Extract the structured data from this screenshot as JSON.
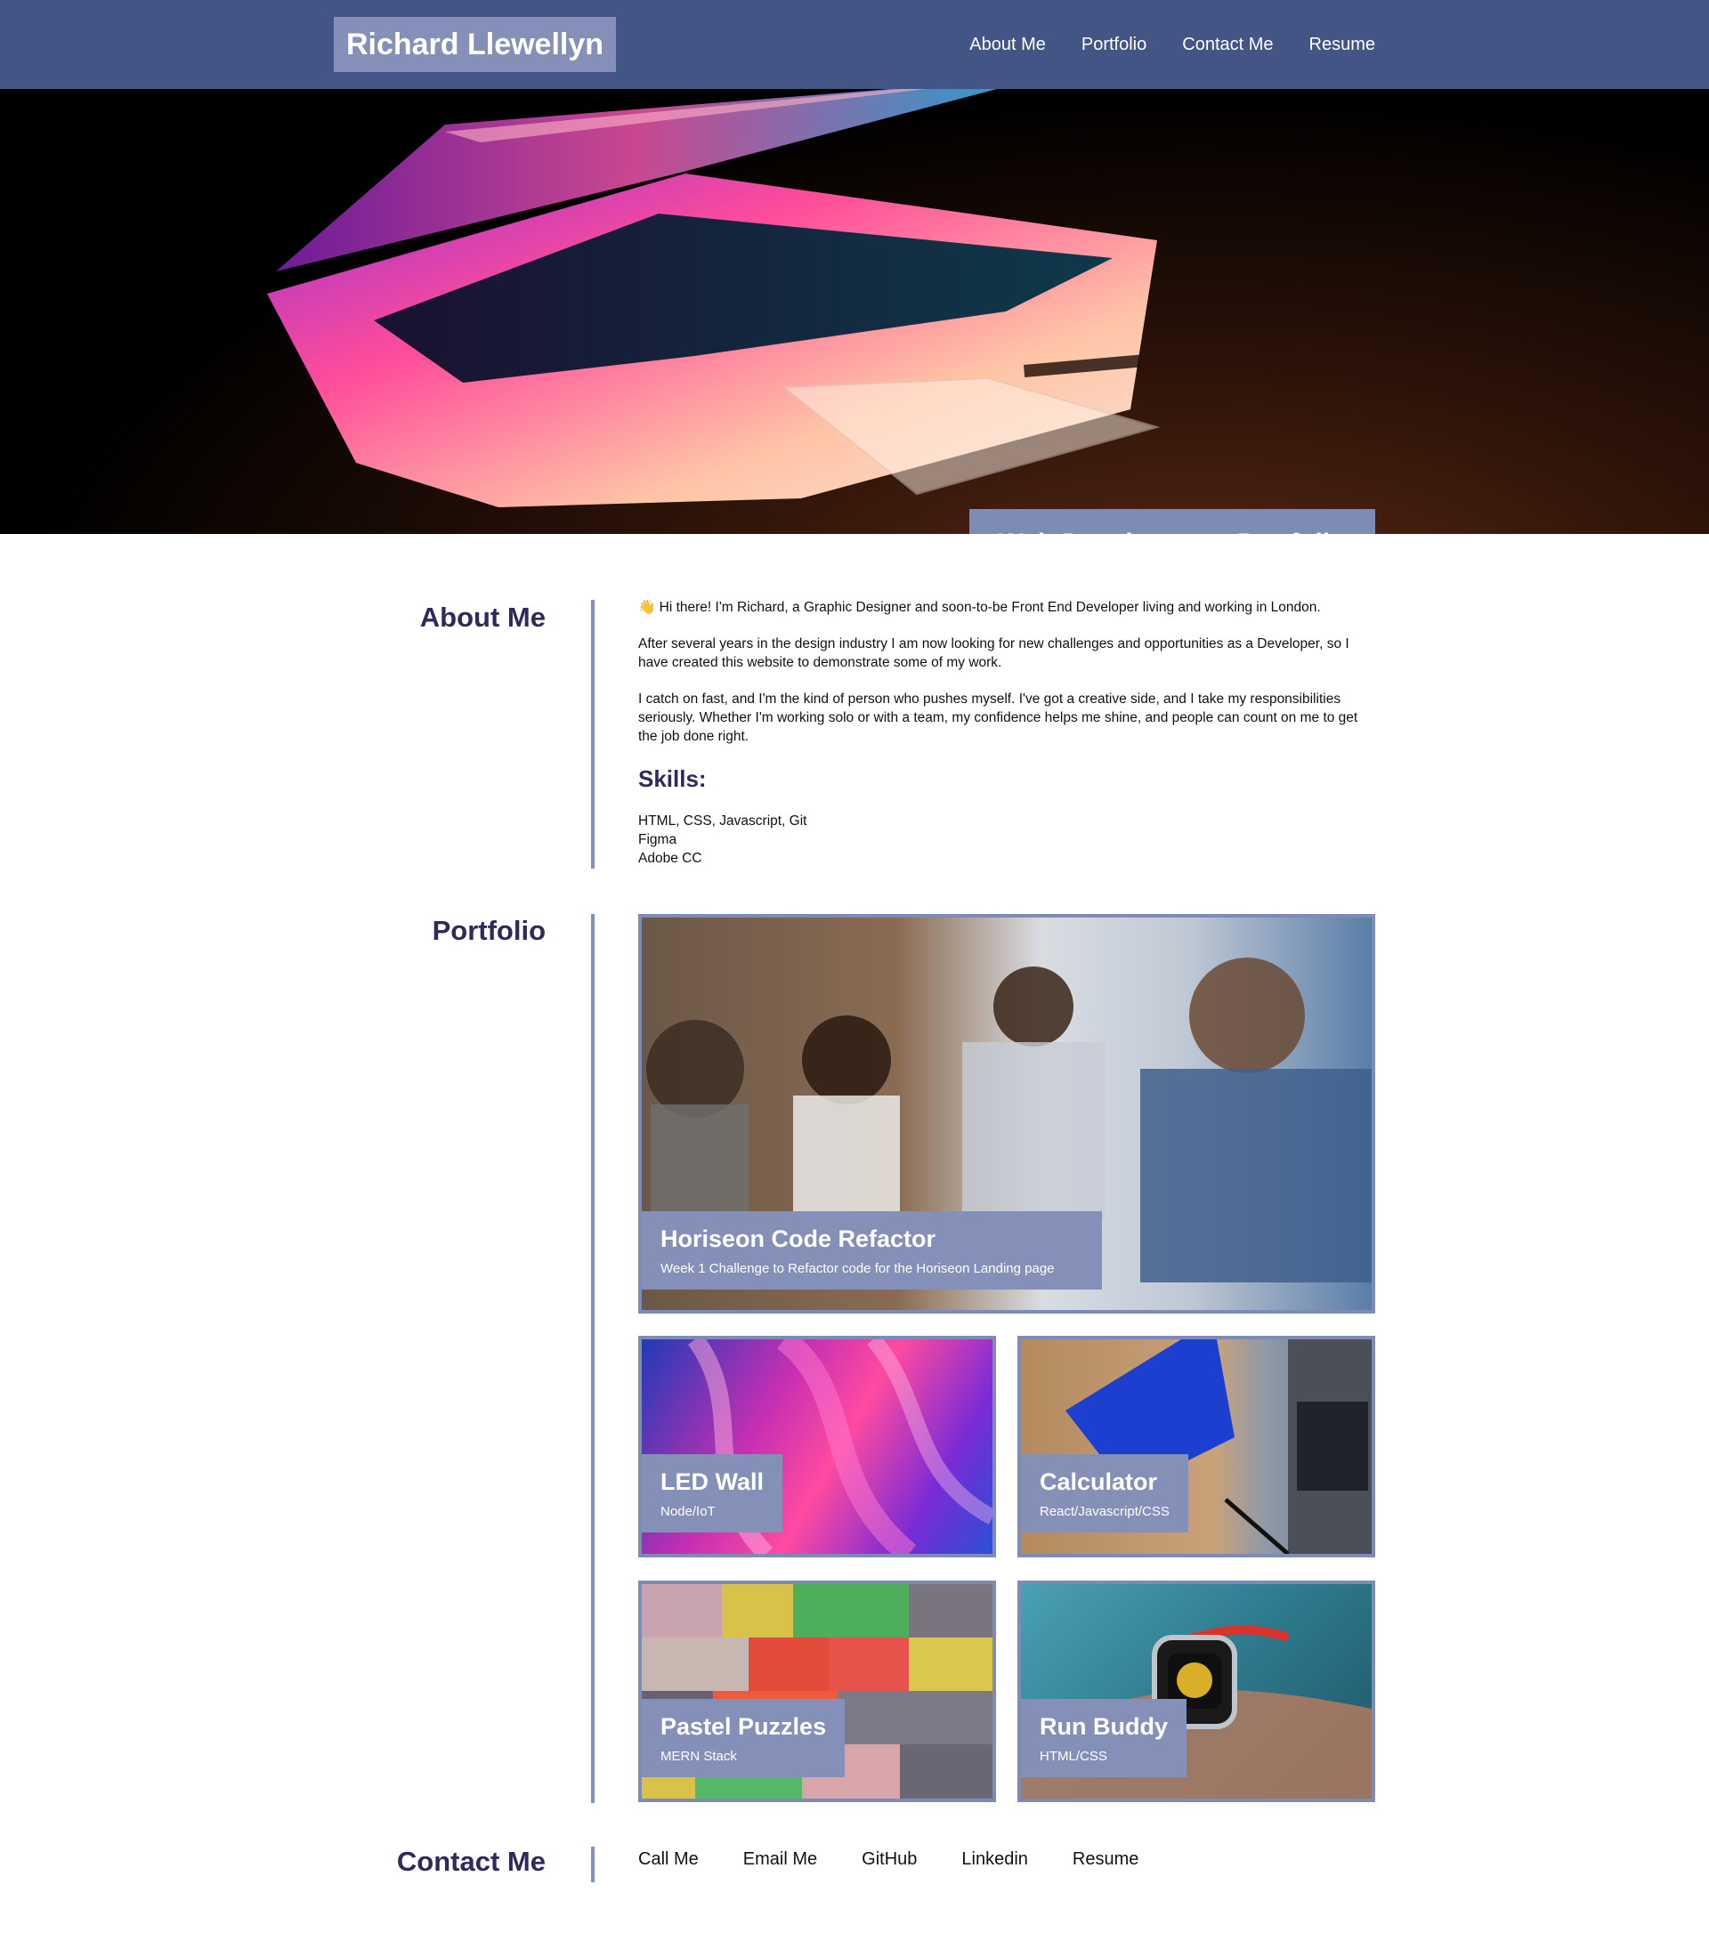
{
  "header": {
    "brand": "Richard Llewellyn",
    "nav": [
      "About Me",
      "Portfolio",
      "Contact Me",
      "Resume"
    ]
  },
  "hero": {
    "caption": "Web Development Portfolio"
  },
  "about": {
    "title": "About Me",
    "wave_icon": "waving-hand-icon",
    "paragraphs": [
      "Hi there! I'm Richard, a Graphic Designer and soon-to-be Front End Developer living and working in London.",
      "After several years in the design industry I am now looking for new challenges and opportunities as a Developer, so I have created this website to demonstrate some of my work.",
      "I catch on fast, and I'm the kind of person who pushes myself. I've got a creative side, and I take my responsibilities seriously. Whether I'm working solo or with a team, my confidence helps me shine, and people can count on me to get the job done right."
    ],
    "skills_title": "Skills:",
    "skills": [
      "HTML, CSS, Javascript, Git",
      "Figma",
      "Adobe CC"
    ]
  },
  "portfolio": {
    "title": "Portfolio",
    "projects": [
      {
        "title": "Horiseon Code Refactor",
        "subtitle": "Week 1 Challenge to Refactor code for the Horiseon Landing page"
      },
      {
        "title": "LED Wall",
        "subtitle": "Node/IoT"
      },
      {
        "title": "Calculator",
        "subtitle": "React/Javascript/CSS"
      },
      {
        "title": "Pastel Puzzles",
        "subtitle": "MERN Stack"
      },
      {
        "title": "Run Buddy",
        "subtitle": "HTML/CSS"
      }
    ]
  },
  "contact": {
    "title": "Contact Me",
    "links": [
      "Call Me",
      "Email Me",
      "GitHub",
      "Linkedin",
      "Resume"
    ]
  },
  "colors": {
    "header_bg": "#435584",
    "accent": "#8490b8",
    "heading": "#2e2a5c"
  }
}
